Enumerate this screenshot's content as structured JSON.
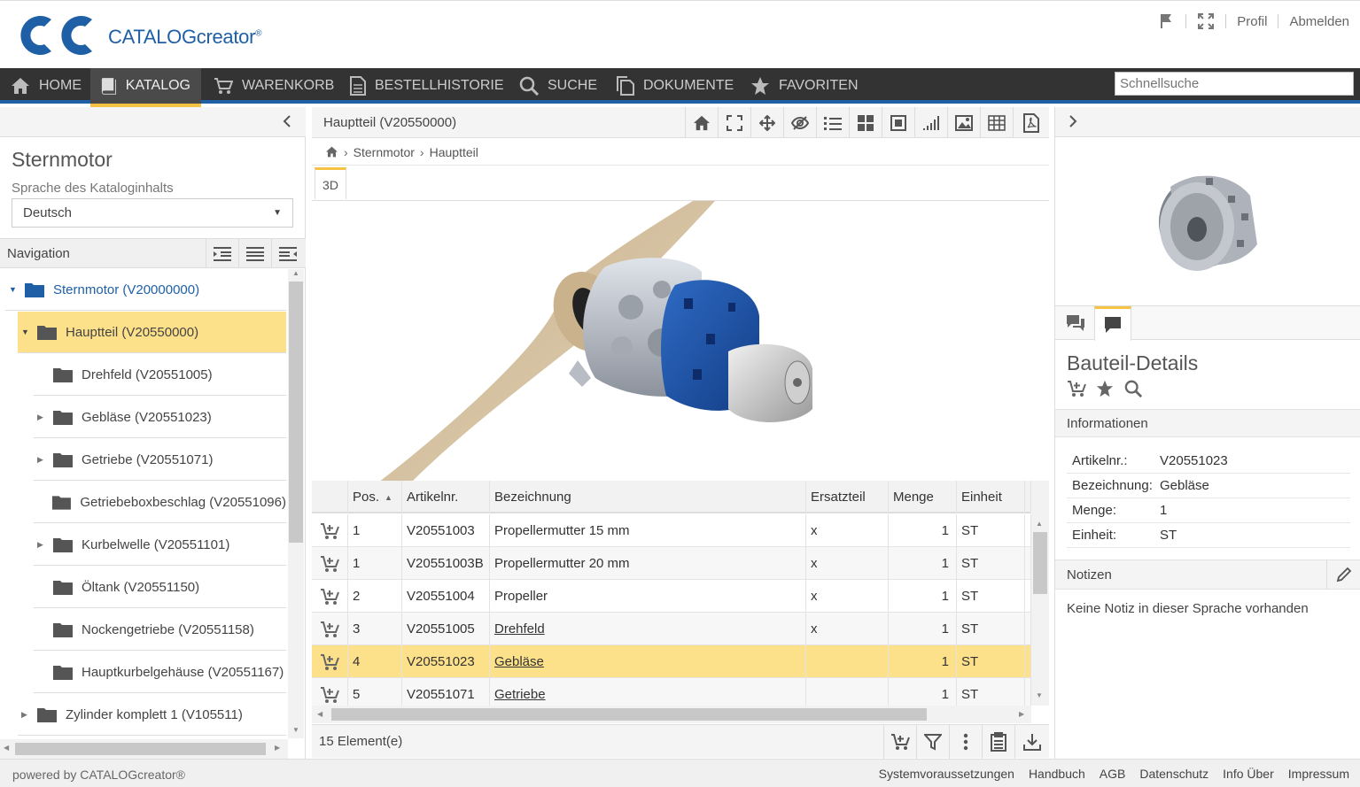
{
  "app": {
    "brand": "CATALOGcreator",
    "brand_mark": "®"
  },
  "header": {
    "links": {
      "profile": "Profil",
      "logout": "Abmelden"
    }
  },
  "nav": {
    "tabs": [
      {
        "label": "HOME",
        "icon": "home-icon"
      },
      {
        "label": "KATALOG",
        "icon": "book-icon",
        "active": true
      },
      {
        "label": "WARENKORB",
        "icon": "cart-icon"
      },
      {
        "label": "BESTELLHISTORIE",
        "icon": "document-icon"
      },
      {
        "label": "SUCHE",
        "icon": "search-icon"
      },
      {
        "label": "DOKUMENTE",
        "icon": "documents-icon"
      },
      {
        "label": "FAVORITEN",
        "icon": "star-icon"
      }
    ],
    "quicksearch_placeholder": "Schnellsuche"
  },
  "left": {
    "catalog_title": "Sternmotor",
    "language_label": "Sprache des Kataloginhalts",
    "language_value": "Deutsch",
    "navigation_label": "Navigation",
    "tree": [
      {
        "label": "Sternmotor (V20000000)",
        "level": 0,
        "expanded": true,
        "color": "#1f5fa6"
      },
      {
        "label": "Hauptteil (V20550000)",
        "level": 1,
        "expanded": true,
        "selected": true
      },
      {
        "label": "Drehfeld (V20551005)",
        "level": 2
      },
      {
        "label": "Gebläse (V20551023)",
        "level": 2,
        "has_children": true
      },
      {
        "label": "Getriebe (V20551071)",
        "level": 2,
        "has_children": true
      },
      {
        "label": "Getriebeboxbeschlag (V20551096)",
        "level": 2
      },
      {
        "label": "Kurbelwelle (V20551101)",
        "level": 2,
        "has_children": true
      },
      {
        "label": "Öltank (V20551150)",
        "level": 2
      },
      {
        "label": "Nockengetriebe (V20551158)",
        "level": 2
      },
      {
        "label": "Hauptkurbelgehäuse (V20551167)",
        "level": 2
      },
      {
        "label": "Zylinder komplett 1 (V105511)",
        "level": 1,
        "has_children": true
      }
    ]
  },
  "center": {
    "title": "Hauptteil (V20550000)",
    "breadcrumb": [
      "Sternmotor",
      "Hauptteil"
    ],
    "view_tab": "3D",
    "table": {
      "headers": [
        "Pos.",
        "Artikelnr.",
        "Bezeichnung",
        "Ersatzteil",
        "Menge",
        "Einheit"
      ],
      "rows": [
        {
          "pos": "1",
          "art": "V20551003",
          "bez": "Propellermutter 15 mm",
          "ers": "x",
          "menge": "1",
          "einheit": "ST",
          "link": false
        },
        {
          "pos": "1",
          "art": "V20551003B",
          "bez": "Propellermutter 20 mm",
          "ers": "x",
          "menge": "1",
          "einheit": "ST",
          "link": false
        },
        {
          "pos": "2",
          "art": "V20551004",
          "bez": "Propeller",
          "ers": "x",
          "menge": "1",
          "einheit": "ST",
          "link": false
        },
        {
          "pos": "3",
          "art": "V20551005",
          "bez": "Drehfeld",
          "ers": "x",
          "menge": "1",
          "einheit": "ST",
          "link": true
        },
        {
          "pos": "4",
          "art": "V20551023",
          "bez": "Gebläse",
          "ers": "",
          "menge": "1",
          "einheit": "ST",
          "link": true,
          "selected": true
        },
        {
          "pos": "5",
          "art": "V20551071",
          "bez": "Getriebe",
          "ers": "",
          "menge": "1",
          "einheit": "ST",
          "link": true
        }
      ]
    },
    "element_count": "15 Element(e)"
  },
  "right": {
    "details_title": "Bauteil-Details",
    "info_label": "Informationen",
    "info": [
      {
        "k": "Artikelnr.:",
        "v": "V20551023"
      },
      {
        "k": "Bezeichnung:",
        "v": "Gebläse"
      },
      {
        "k": "Menge:",
        "v": "1"
      },
      {
        "k": "Einheit:",
        "v": "ST"
      }
    ],
    "notes_label": "Notizen",
    "notes_text": "Keine Notiz in dieser Sprache vorhanden"
  },
  "footer": {
    "powered": "powered by CATALOGcreator®",
    "links": [
      "Systemvoraussetzungen",
      "Handbuch",
      "AGB",
      "Datenschutz",
      "Info Über",
      "Impressum"
    ]
  },
  "colors": {
    "accent": "#1f5fa6",
    "highlight": "#fde08a",
    "tab_active": "#f6c244",
    "navbar": "#333333"
  }
}
